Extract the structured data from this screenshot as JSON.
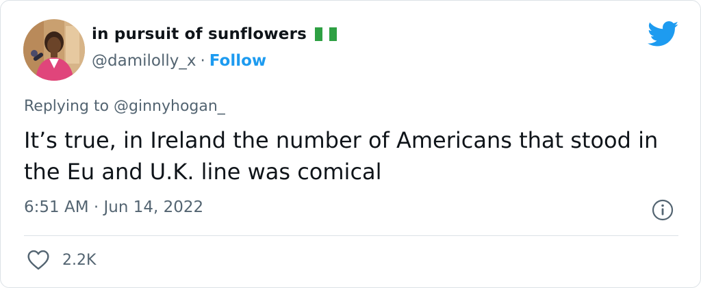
{
  "author": {
    "display_name": "in pursuit of sunflowers",
    "flag_icon": "nigeria-flag-icon",
    "handle": "@damilolly_x",
    "separator": "·",
    "follow_label": "Follow"
  },
  "reply": {
    "label": "Replying to @ginnyhogan_"
  },
  "tweet": {
    "text": "It’s true, in Ireland the number of Americans that stood in the Eu and U.K. line was comical",
    "timestamp": "6:51 AM · Jun 14, 2022"
  },
  "stats": {
    "like_count": "2.2K"
  },
  "colors": {
    "link": "#1d9bf0",
    "muted": "#536471",
    "text": "#0f1419",
    "divider": "#dbe1e6"
  },
  "icons": {
    "brand": "twitter-bird-icon",
    "info": "info-icon",
    "like": "heart-icon"
  }
}
